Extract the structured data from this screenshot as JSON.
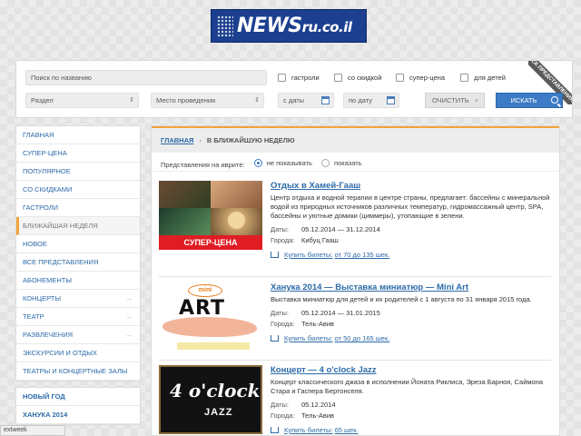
{
  "logo": {
    "name": "NEWS",
    "domain": "ru.co.il"
  },
  "search": {
    "name_placeholder": "Поиск по названию",
    "section": "Раздел",
    "venue": "Место проведения",
    "date_from": "с даты",
    "date_to": "по дату",
    "checkboxes": [
      "гастроли",
      "со скидкой",
      "супер-цена",
      "для детей"
    ],
    "clear_label": "ОЧИСТИТЬ",
    "search_label": "ИСКАТЬ",
    "ribbon": "ПОИСК ПРЕДСТАВЛЕНИЯ:"
  },
  "sidebar": {
    "items": [
      {
        "label": "ГЛАВНАЯ"
      },
      {
        "label": "СУПЕР-ЦЕНА"
      },
      {
        "label": "ПОПУЛЯРНОЕ"
      },
      {
        "label": "СО СКИДКАМИ"
      },
      {
        "label": "ГАСТРОЛИ"
      },
      {
        "label": "БЛИЖАЙШАЯ НЕДЕЛЯ"
      },
      {
        "label": "НОВОЕ"
      },
      {
        "label": "ВСЕ ПРЕДСТАВЛЕНИЯ"
      },
      {
        "label": "АБОНЕМЕНТЫ"
      },
      {
        "label": "КОНЦЕРТЫ"
      },
      {
        "label": "ТЕАТР"
      },
      {
        "label": "РАЗВЛЕЧЕНИЯ"
      },
      {
        "label": "ЭКСКУРСИИ И ОТДЫХ"
      },
      {
        "label": "ТЕАТРЫ И КОНЦЕРТНЫЕ ЗАЛЫ"
      }
    ],
    "extra": [
      {
        "label": "НОВЫЙ ГОД"
      },
      {
        "label": "ХАНУКА 2014"
      }
    ]
  },
  "breadcrumb": {
    "home": "ГЛАВНАЯ",
    "current": "В БЛИЖАЙШУЮ НЕДЕЛЮ"
  },
  "hebrew_filter": {
    "label": "Представления на иврите:",
    "option_hide": "не показывать",
    "option_show": "показать"
  },
  "events": [
    {
      "title": "Отдых в Хамей-Гааш",
      "desc": "Центр отдыха и водной терапии в центре страны, предлагает: бассейны с минеральной водой из природных источников различных температур, гидромассажный центр, SPA, бассейны и уютные домики (циммеры), утопающие в зелени.",
      "dates_label": "Даты:",
      "dates": "05.12.2014 — 31.12.2014",
      "cities_label": "Города:",
      "cities": "Кибуц Гааш",
      "buy_prefix": "Купить билеты:",
      "buy_price": "от 70 до 135 шек.",
      "badge": "СУПЕР-ЦЕНА"
    },
    {
      "title": "Ханука 2014 — Выставка миниатюр — Mini Art",
      "desc": "Выставка миниатюр для детей и их родителей с 1 августа по 31 января 2015 года.",
      "dates_label": "Даты:",
      "dates": "05.12.2014 — 31.01.2015",
      "cities_label": "Города:",
      "cities": "Тель-Авив",
      "buy_prefix": "Купить билеты:",
      "buy_price": "от 50 до 165 шек.",
      "img_top": "mini",
      "img_word": "ART"
    },
    {
      "title": "Концерт — 4 o'clock Jazz",
      "desc": "Концерт классического джаза в исполнении Йоната Риклиса, Эреза Барноя, Саймона Стара и Гаспера Бертонселя.",
      "dates_label": "Даты:",
      "dates": "05.12.2014",
      "cities_label": "Города:",
      "cities": "Тель-Авив",
      "buy_prefix": "Купить билеты:",
      "buy_price": "65 шек.",
      "img_big": "4 o'clock",
      "img_word": "JAZZ"
    }
  ],
  "status": "extweek",
  "colors": {
    "accent": "#3e7bc6",
    "link": "#2c6aa8",
    "active_marker": "#f2a33a",
    "super_price": "#e01c24"
  }
}
